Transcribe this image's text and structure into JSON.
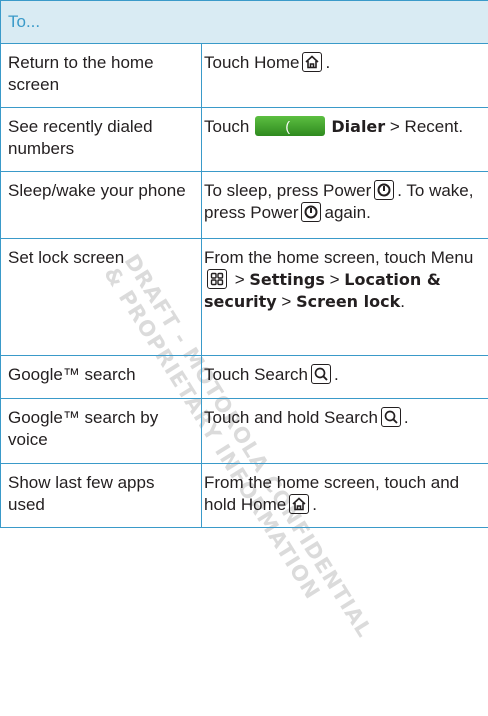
{
  "header": "To...",
  "watermark": {
    "line1": "DRAFT - MOTOROLA CONFIDENTIAL",
    "line2": "& PROPRIETARY INFORMATION"
  },
  "rows": [
    {
      "task": "Return to the home screen",
      "a1": "Touch Home",
      "a2": ".",
      "icon": "home-icon"
    },
    {
      "task": "See recently dialed numbers",
      "a1": "Touch",
      "dialer_glyph": "(",
      "a2": "Dialer",
      "a3": " > Recent."
    },
    {
      "task": "Sleep/wake your phone",
      "a1": "To sleep, press Power",
      "a2": ". To wake, press Power",
      "a3": "again."
    },
    {
      "task": "Set lock screen",
      "a1": "From the home screen, touch Menu",
      "a2": " > ",
      "b1": "Settings",
      "a3": " > ",
      "b2": "Location & security",
      "a4": " > ",
      "b3": "Screen lock",
      "a5": "."
    },
    {
      "task": "Google™ search",
      "a1": "Touch Search",
      "a2": "."
    },
    {
      "task": "Google™ search by voice",
      "a1": "Touch and hold Search",
      "a2": "."
    },
    {
      "task": "Show last few apps used",
      "a1": "From the home screen, touch and hold Home",
      "a2": "."
    }
  ]
}
